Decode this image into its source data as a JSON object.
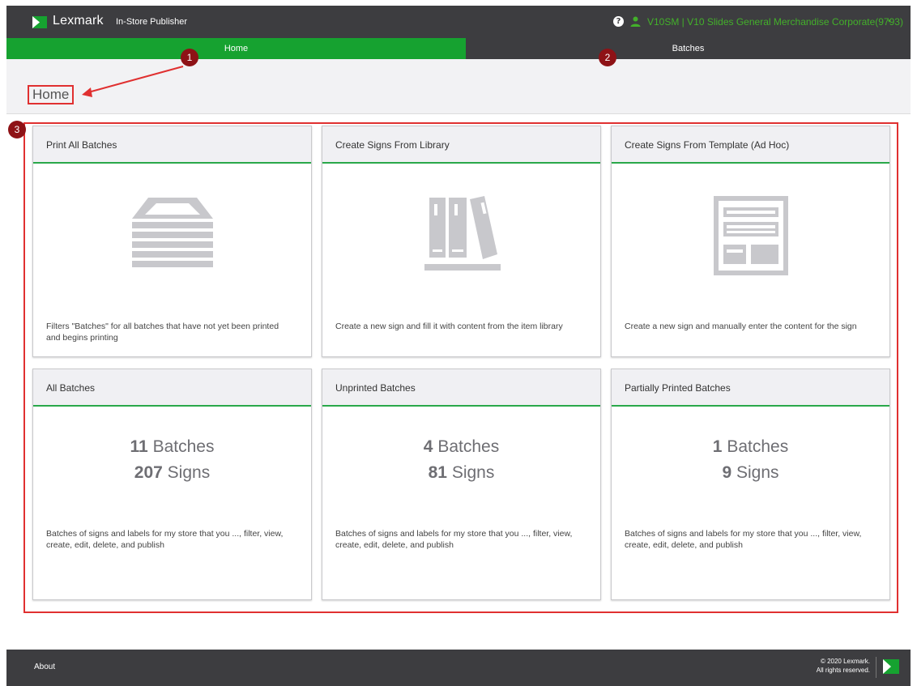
{
  "header": {
    "brand": "Lexmark",
    "app_name": "In-Store Publisher",
    "help_glyph": "?",
    "user_label": "V10SM | V10 Slides General Merchandise Corporate(9793)",
    "caret": "▾"
  },
  "nav": {
    "home": "Home",
    "batches": "Batches"
  },
  "page": {
    "title": "Home"
  },
  "annotations": {
    "badge1": "1",
    "badge2": "2",
    "badge3": "3"
  },
  "cards": {
    "print_all": {
      "title": "Print All Batches",
      "icon": "tray-stack-icon",
      "desc": "Filters \"Batches\" for all batches that have not yet been printed and begins printing"
    },
    "library": {
      "title": "Create Signs From Library",
      "icon": "library-books-icon",
      "desc": "Create a new sign and fill it with content from the item library"
    },
    "template": {
      "title": "Create Signs From Template (Ad Hoc)",
      "icon": "template-layout-icon",
      "desc": "Create a new sign and manually enter the content for the sign"
    },
    "all_batches": {
      "title": "All Batches",
      "batch_count": "11",
      "batch_word": "Batches",
      "sign_count": "207",
      "sign_word": "Signs",
      "desc": "Batches of signs and labels for my store that you ..., filter, view, create, edit, delete, and publish"
    },
    "unprinted": {
      "title": "Unprinted Batches",
      "batch_count": "4",
      "batch_word": "Batches",
      "sign_count": "81",
      "sign_word": "Signs",
      "desc": "Batches of signs and labels for my store that you ..., filter, view, create, edit, delete, and publish"
    },
    "partial": {
      "title": "Partially Printed Batches",
      "batch_count": "1",
      "batch_word": "Batches",
      "sign_count": "9",
      "sign_word": "Signs",
      "desc": "Batches of signs and labels for my store that you ..., filter, view, create, edit, delete, and publish"
    }
  },
  "footer": {
    "about": "About",
    "copyright_line1": "© 2020 Lexmark.",
    "copyright_line2": "All rights reserved."
  },
  "colors": {
    "header_bg": "#3d3d40",
    "accent_green": "#16a230",
    "user_green": "#43b02a",
    "annotation_red": "#e03030",
    "badge_red": "#8e1216",
    "icon_gray": "#c8c8cc"
  }
}
